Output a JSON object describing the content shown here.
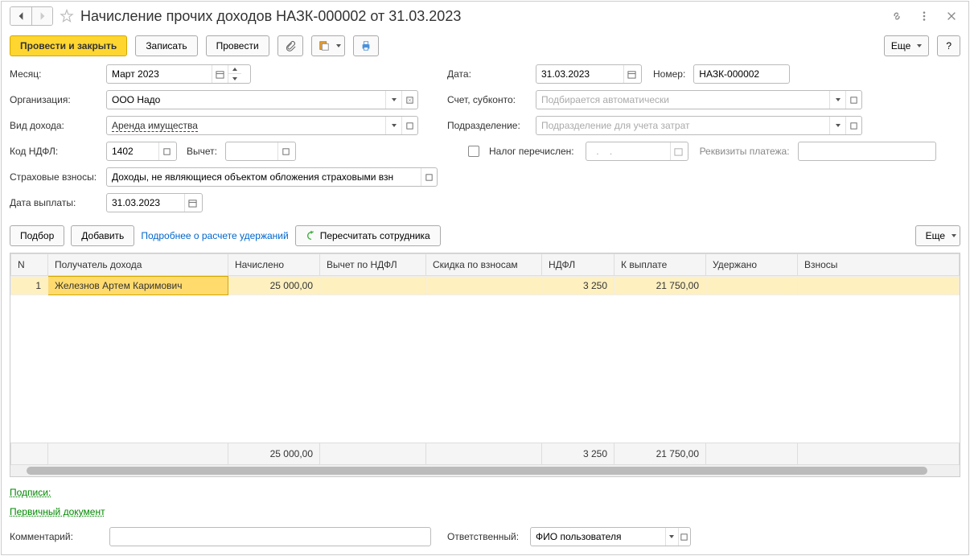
{
  "title": "Начисление прочих доходов НАЗК-000002 от 31.03.2023",
  "toolbar": {
    "post_close": "Провести и закрыть",
    "save": "Записать",
    "post": "Провести",
    "more": "Еще",
    "help": "?"
  },
  "fields": {
    "month_label": "Месяц:",
    "month_value": "Март 2023",
    "date_label": "Дата:",
    "date_value": "31.03.2023",
    "number_label": "Номер:",
    "number_value": "НАЗК-000002",
    "org_label": "Организация:",
    "org_value": "ООО Надо",
    "account_label": "Счет, субконто:",
    "account_placeholder": "Подбирается автоматически",
    "income_type_label": "Вид дохода:",
    "income_type_value": "Аренда имущества",
    "dept_label": "Подразделение:",
    "dept_placeholder": "Подразделение для учета затрат",
    "ndfl_code_label": "Код НДФЛ:",
    "ndfl_code_value": "1402",
    "deduction_label": "Вычет:",
    "tax_paid_label": "Налог перечислен:",
    "tax_date_placeholder": "  .    .      ",
    "payment_details_label": "Реквизиты платежа:",
    "insurance_label": "Страховые взносы:",
    "insurance_value": "Доходы, не являющиеся объектом обложения страховыми взн",
    "payout_date_label": "Дата выплаты:",
    "payout_date_value": "31.03.2023"
  },
  "actions": {
    "select": "Подбор",
    "add": "Добавить",
    "details_link": "Подробнее о расчете удержаний",
    "recalc": "Пересчитать сотрудника",
    "more": "Еще"
  },
  "table": {
    "headers": {
      "n": "N",
      "recipient": "Получатель дохода",
      "accrued": "Начислено",
      "ndfl_deduction": "Вычет по НДФЛ",
      "contrib_discount": "Скидка по взносам",
      "ndfl": "НДФЛ",
      "to_pay": "К выплате",
      "withheld": "Удержано",
      "contributions": "Взносы"
    },
    "rows": [
      {
        "n": "1",
        "recipient": "Железнов Артем Каримович",
        "accrued": "25 000,00",
        "ndfl_deduction": "",
        "contrib_discount": "",
        "ndfl": "3 250",
        "to_pay": "21 750,00",
        "withheld": "",
        "contributions": ""
      }
    ],
    "totals": {
      "accrued": "25 000,00",
      "ndfl": "3 250",
      "to_pay": "21 750,00"
    }
  },
  "footer": {
    "signatures": "Подписи:",
    "primary_doc": "Первичный документ",
    "comment_label": "Комментарий:",
    "responsible_label": "Ответственный:",
    "responsible_value": "ФИО пользователя"
  }
}
